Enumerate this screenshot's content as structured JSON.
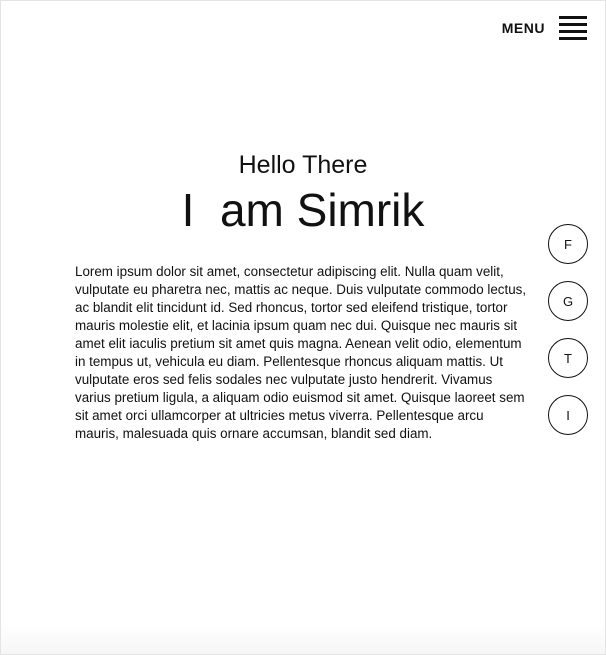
{
  "header": {
    "menu_label": "MENU"
  },
  "hero": {
    "greeting": "Hello There",
    "headline": "I  am Simrik"
  },
  "bio": {
    "text": "Lorem ipsum dolor sit amet, consectetur adipiscing elit. Nulla quam velit, vulputate eu pharetra nec, mattis ac neque. Duis vulputate commodo lectus, ac blandit elit tincidunt id. Sed rhoncus, tortor sed eleifend tristique, tortor mauris molestie elit, et lacinia ipsum quam nec dui. Quisque nec mauris sit amet elit iaculis pretium sit amet quis magna. Aenean velit odio, elementum in tempus ut, vehicula eu diam. Pellentesque rhoncus aliquam mattis. Ut vulputate eros sed felis sodales nec vulputate justo hendrerit. Vivamus varius pretium ligula, a aliquam odio euismod sit amet. Quisque laoreet sem sit amet orci ullamcorper at ultricies metus viverra. Pellentesque arcu mauris, malesuada quis ornare accumsan, blandit sed diam."
  },
  "social": {
    "items": [
      {
        "label": "F",
        "icon": "facebook-icon"
      },
      {
        "label": "G",
        "icon": "google-icon"
      },
      {
        "label": "T",
        "icon": "twitter-icon"
      },
      {
        "label": "I",
        "icon": "instagram-icon"
      }
    ]
  },
  "colors": {
    "background": "#ffffff",
    "text": "#111111",
    "border": "#e4e4e4"
  }
}
